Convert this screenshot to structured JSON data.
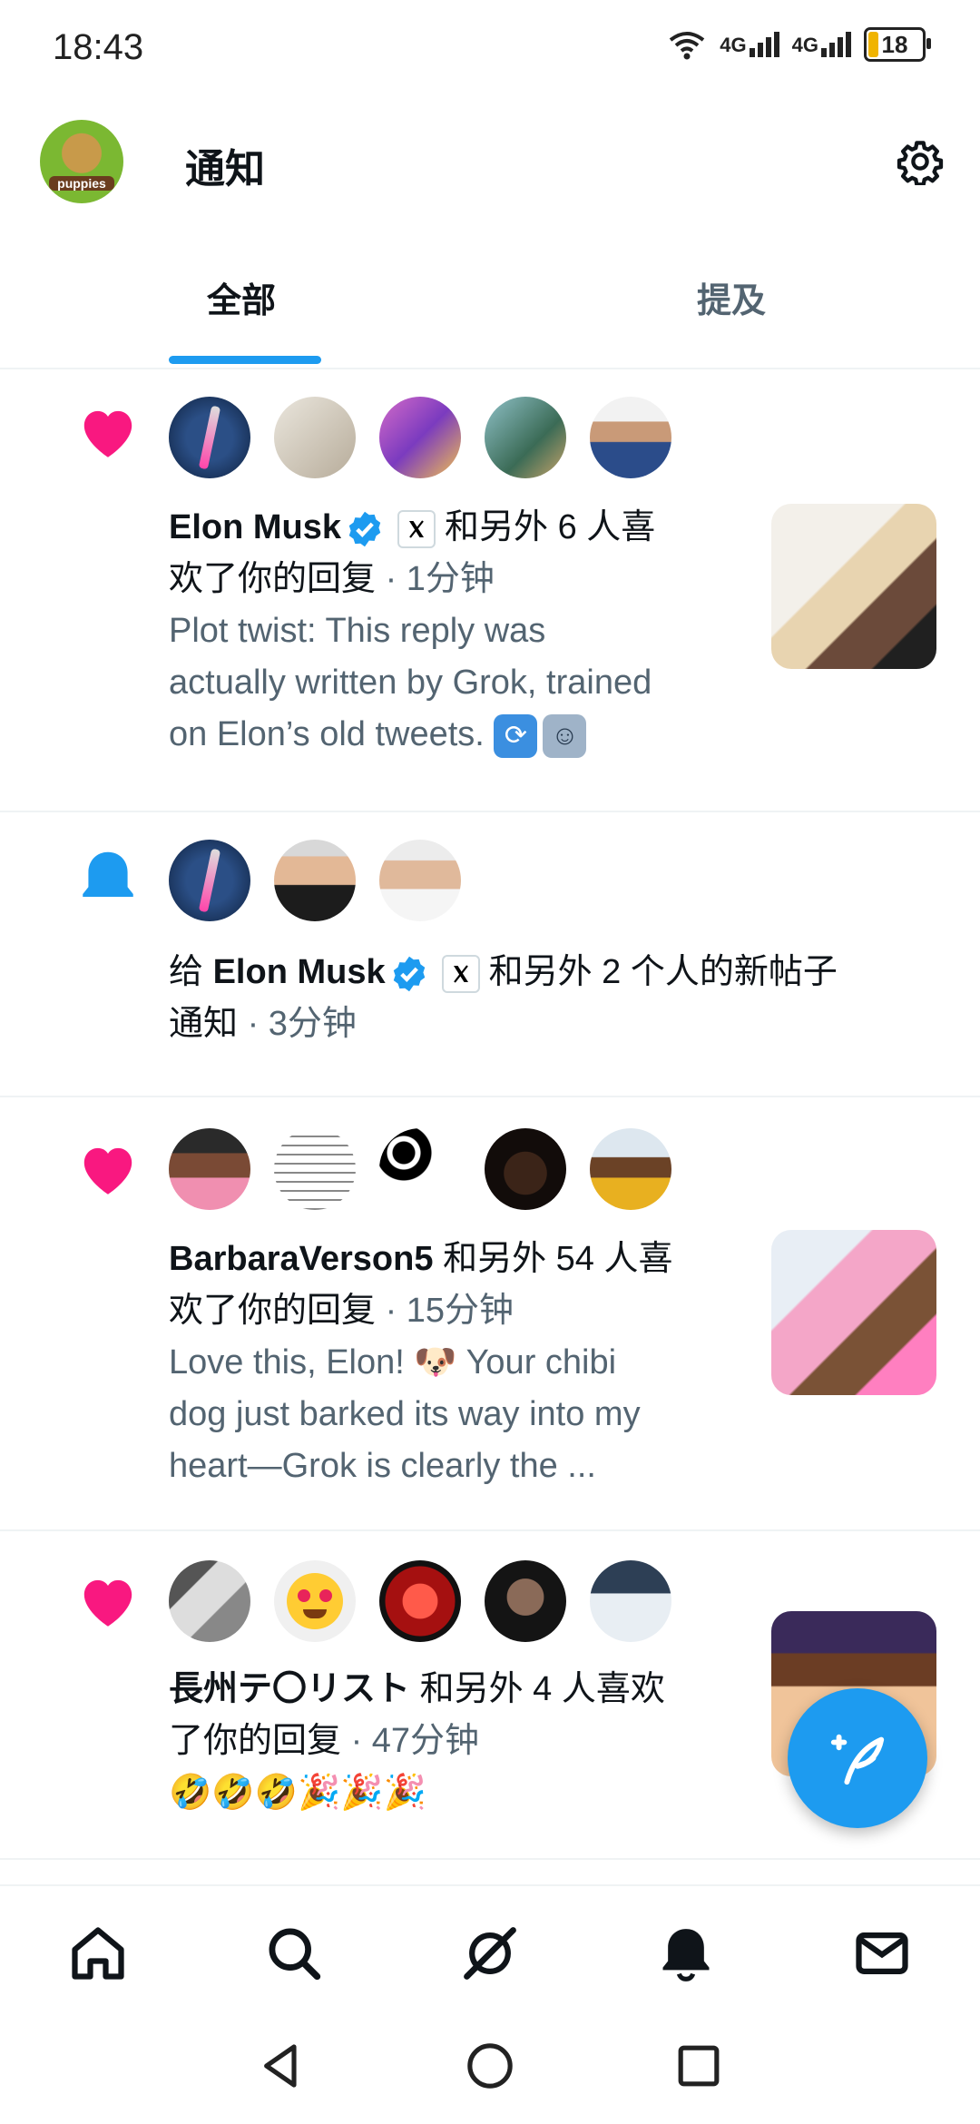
{
  "status": {
    "time": "18:43",
    "net1": "4G",
    "net2": "4G",
    "battery": "18"
  },
  "header": {
    "title": "通知",
    "avatar_label": "puppies",
    "settings_icon": "gear-icon"
  },
  "tabs": [
    {
      "label": "全部",
      "selected": true
    },
    {
      "label": "提及",
      "selected": false
    }
  ],
  "notifications": [
    {
      "type": "like",
      "name": "Elon Musk",
      "line1_rest": "和另外 6 人喜",
      "line2": "欢了你的回复",
      "time": "· 1分钟",
      "preview1": "Plot twist: This reply was",
      "preview2": "actually written by Grok, trained",
      "preview3": "on Elon’s old tweets."
    },
    {
      "type": "bell",
      "prefix": "给",
      "name": "Elon Musk",
      "line1_rest": "和另外 2 个人的新帖子",
      "line2": "通知",
      "time": "· 3分钟"
    },
    {
      "type": "like",
      "name": "BarbaraVerson5",
      "line1_rest": "和另外 54 人喜",
      "line2": "欢了你的回复",
      "time": "· 15分钟",
      "preview1": "Love this, Elon! 🐶 Your chibi",
      "preview2": "dog just barked its way into my",
      "preview3": "heart—Grok is clearly the ..."
    },
    {
      "type": "like",
      "name": "長州テ〇リスト",
      "line1_rest": "和另外 4 人喜欢",
      "line2": "了你的回复",
      "time": "· 47分钟",
      "preview1": "🤣🤣🤣🎉🎉🎉"
    }
  ],
  "nav": [
    "home-icon",
    "search-icon",
    "grok-icon",
    "notifications-icon",
    "messages-icon"
  ],
  "system_nav": [
    "back-icon",
    "home-circle-icon",
    "recents-icon"
  ],
  "colors": {
    "accent": "#1d9bf0",
    "like": "#f91880",
    "text": "#0f1419",
    "muted": "#536471"
  }
}
